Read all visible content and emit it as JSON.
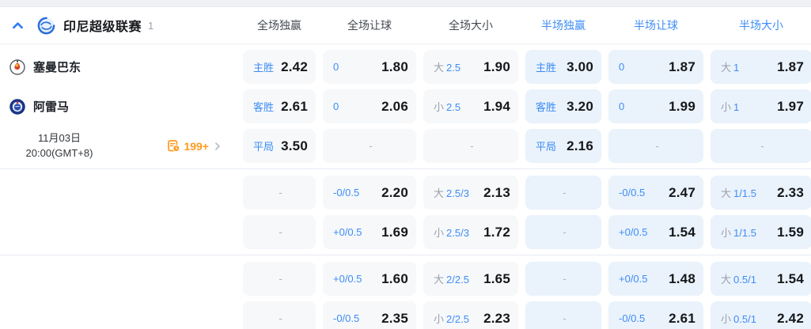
{
  "header": {
    "league_name": "印尼超级联赛",
    "league_count": "1",
    "collapse_icon": "chevron-up-icon",
    "league_logo_icon": "league-logo-icon",
    "columns": [
      {
        "label": "全场独赢",
        "period": "full"
      },
      {
        "label": "全场让球",
        "period": "full"
      },
      {
        "label": "全场大小",
        "period": "full"
      },
      {
        "label": "半场独赢",
        "period": "half"
      },
      {
        "label": "半场让球",
        "period": "half"
      },
      {
        "label": "半场大小",
        "period": "half"
      }
    ]
  },
  "match": {
    "home_team": "塞曼巴东",
    "away_team": "阿雷马",
    "date": "11月03日",
    "time": "20:00(GMT+8)",
    "more_markets_count": "199+",
    "more_markets_icon": "markets-clock-icon",
    "more_markets_chevron": "chevron-right-icon"
  },
  "dash_char": "-",
  "rows": [
    {
      "left": "home",
      "cells": [
        {
          "label": "主胜",
          "value": "2.42"
        },
        {
          "label": "0",
          "value": "1.80"
        },
        {
          "prefix": "大",
          "label": "2.5",
          "value": "1.90"
        },
        {
          "label": "主胜",
          "value": "3.00"
        },
        {
          "label": "0",
          "value": "1.87"
        },
        {
          "prefix": "大",
          "label": "1",
          "value": "1.87"
        }
      ]
    },
    {
      "left": "away",
      "cells": [
        {
          "label": "客胜",
          "value": "2.61"
        },
        {
          "label": "0",
          "value": "2.06"
        },
        {
          "prefix": "小",
          "label": "2.5",
          "value": "1.94"
        },
        {
          "label": "客胜",
          "value": "3.20"
        },
        {
          "label": "0",
          "value": "1.99"
        },
        {
          "prefix": "小",
          "label": "1",
          "value": "1.97"
        }
      ]
    },
    {
      "left": "meta",
      "cells": [
        {
          "label": "平局",
          "value": "3.50"
        },
        {
          "dash": true
        },
        {
          "dash": true
        },
        {
          "label": "平局",
          "value": "2.16"
        },
        {
          "dash": true
        },
        {
          "dash": true
        }
      ]
    },
    {
      "left": "",
      "cells": [
        {
          "dash": true
        },
        {
          "label": "-0/0.5",
          "value": "2.20"
        },
        {
          "prefix": "大",
          "label": "2.5/3",
          "value": "2.13"
        },
        {
          "dash": true
        },
        {
          "label": "-0/0.5",
          "value": "2.47"
        },
        {
          "prefix": "大",
          "label": "1/1.5",
          "value": "2.33"
        }
      ]
    },
    {
      "left": "",
      "cells": [
        {
          "dash": true
        },
        {
          "label": "+0/0.5",
          "value": "1.69"
        },
        {
          "prefix": "小",
          "label": "2.5/3",
          "value": "1.72"
        },
        {
          "dash": true
        },
        {
          "label": "+0/0.5",
          "value": "1.54"
        },
        {
          "prefix": "小",
          "label": "1/1.5",
          "value": "1.59"
        }
      ]
    },
    {
      "left": "",
      "cells": [
        {
          "dash": true
        },
        {
          "label": "+0/0.5",
          "value": "1.60"
        },
        {
          "prefix": "大",
          "label": "2/2.5",
          "value": "1.65"
        },
        {
          "dash": true
        },
        {
          "label": "+0/0.5",
          "value": "1.48"
        },
        {
          "prefix": "大",
          "label": "0.5/1",
          "value": "1.54"
        }
      ]
    },
    {
      "left": "",
      "cells": [
        {
          "dash": true
        },
        {
          "label": "-0/0.5",
          "value": "2.35"
        },
        {
          "prefix": "小",
          "label": "2/2.5",
          "value": "2.23"
        },
        {
          "dash": true
        },
        {
          "label": "-0/0.5",
          "value": "2.61"
        },
        {
          "prefix": "小",
          "label": "0.5/1",
          "value": "2.42"
        }
      ]
    }
  ],
  "groups": [
    [
      0,
      1,
      2
    ],
    [
      3,
      4
    ],
    [
      5,
      6
    ]
  ],
  "colors": {
    "accent_blue": "#3d8df6",
    "odds_text": "#15171a",
    "prefix_gray": "#9aa0ab",
    "cell_bg_full": "#f6f8fa",
    "cell_bg_half": "#eaf2fb",
    "orange": "#ff9a1f",
    "divider": "#e6ebf1"
  }
}
